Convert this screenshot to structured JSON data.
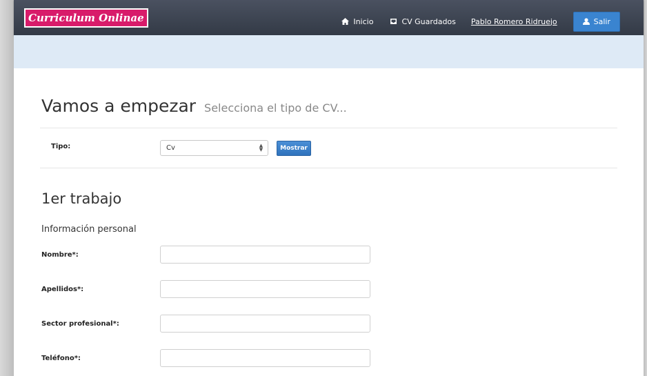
{
  "navbar": {
    "brand": "Curriculum Onlinae",
    "inicio_label": "Inicio",
    "cv_guardados_label": "CV Guardados",
    "user_name": "Pablo  Romero Ridruejo",
    "salir_label": "Salir"
  },
  "page": {
    "title": "Vamos a empezar",
    "subtitle": "Selecciona el tipo de CV..."
  },
  "tipo": {
    "label": "Tipo:",
    "selected": "Cv",
    "button": "Mostrar"
  },
  "section": {
    "title": "1er trabajo",
    "subtitle": "Información personal"
  },
  "fields": [
    {
      "label": "Nombre*:",
      "value": ""
    },
    {
      "label": "Apellidos*:",
      "value": ""
    },
    {
      "label": "Sector profesional*:",
      "value": ""
    },
    {
      "label": "Teléfono*:",
      "value": ""
    }
  ],
  "icons": {
    "inicio": "home-icon",
    "cv_guardados": "inbox-icon",
    "salir": "user-icon",
    "select": "select-caret-icon"
  },
  "colors": {
    "navbar": "#3b414e",
    "brand_bg": "#d81b6a",
    "primary_button": "#3a84d0",
    "subbar": "#deeaf6"
  }
}
